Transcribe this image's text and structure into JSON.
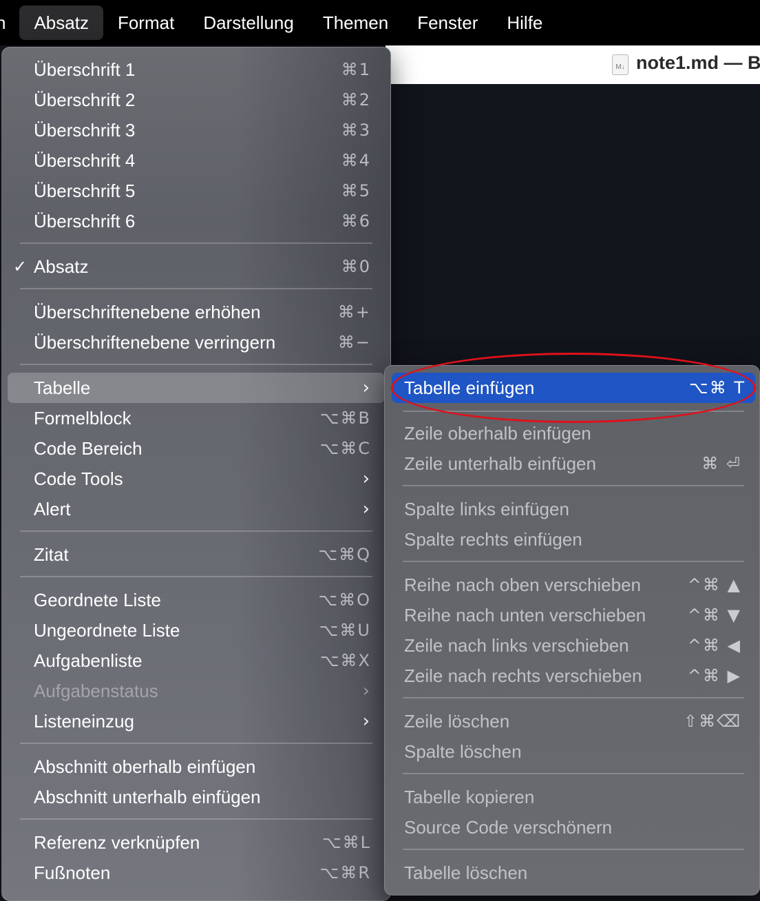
{
  "menubar": {
    "cut_item": "n",
    "items": [
      "Absatz",
      "Format",
      "Darstellung",
      "Themen",
      "Fenster",
      "Hilfe"
    ]
  },
  "window": {
    "doc_icon": "M↓",
    "title": "note1.md — B"
  },
  "main_menu": {
    "items": [
      {
        "label": "Überschrift 1",
        "shortcut": "⌘1"
      },
      {
        "label": "Überschrift 2",
        "shortcut": "⌘2"
      },
      {
        "label": "Überschrift 3",
        "shortcut": "⌘3"
      },
      {
        "label": "Überschrift 4",
        "shortcut": "⌘4"
      },
      {
        "label": "Überschrift 5",
        "shortcut": "⌘5"
      },
      {
        "label": "Überschrift 6",
        "shortcut": "⌘6"
      },
      {
        "label": "Absatz",
        "shortcut": "⌘0",
        "check": "✓"
      },
      {
        "label": "Überschriftenebene erhöhen",
        "shortcut": "⌘+"
      },
      {
        "label": "Überschriftenebene verringern",
        "shortcut": "⌘−"
      },
      {
        "label": "Tabelle",
        "chevron": "›"
      },
      {
        "label": "Formelblock",
        "shortcut": "⌥⌘B"
      },
      {
        "label": "Code Bereich",
        "shortcut": "⌥⌘C"
      },
      {
        "label": "Code Tools",
        "chevron": "›"
      },
      {
        "label": "Alert",
        "chevron": "›"
      },
      {
        "label": "Zitat",
        "shortcut": "⌥⌘Q"
      },
      {
        "label": "Geordnete Liste",
        "shortcut": "⌥⌘O"
      },
      {
        "label": "Ungeordnete Liste",
        "shortcut": "⌥⌘U"
      },
      {
        "label": "Aufgabenliste",
        "shortcut": "⌥⌘X"
      },
      {
        "label": "Aufgabenstatus",
        "chevron": "›"
      },
      {
        "label": "Listeneinzug",
        "chevron": "›"
      },
      {
        "label": "Abschnitt oberhalb einfügen"
      },
      {
        "label": "Abschnitt unterhalb einfügen"
      },
      {
        "label": "Referenz verknüpfen",
        "shortcut": "⌥⌘L"
      },
      {
        "label": "Fußnoten",
        "shortcut": "⌥⌘R"
      }
    ]
  },
  "sub_menu": {
    "items": [
      {
        "label": "Tabelle einfügen",
        "shortcut": "⌥⌘ T"
      },
      {
        "label": "Zeile oberhalb einfügen"
      },
      {
        "label": "Zeile unterhalb einfügen",
        "shortcut": "⌘ ⏎"
      },
      {
        "label": "Spalte links einfügen"
      },
      {
        "label": "Spalte rechts einfügen"
      },
      {
        "label": "Reihe nach oben verschieben",
        "shortcut": "^⌘ ▲"
      },
      {
        "label": "Reihe nach unten verschieben",
        "shortcut": "^⌘ ▼"
      },
      {
        "label": "Zeile nach links verschieben",
        "shortcut": "^⌘ ◀"
      },
      {
        "label": "Zeile nach rechts verschieben",
        "shortcut": "^⌘ ▶"
      },
      {
        "label": "Zeile löschen",
        "shortcut": "⇧⌘⌫"
      },
      {
        "label": "Spalte löschen"
      },
      {
        "label": "Tabelle kopieren"
      },
      {
        "label": "Source Code verschönern"
      },
      {
        "label": "Tabelle löschen"
      }
    ]
  },
  "colors": {
    "selection_blue": "#1f55c4",
    "annotation_red": "#e0111a"
  }
}
